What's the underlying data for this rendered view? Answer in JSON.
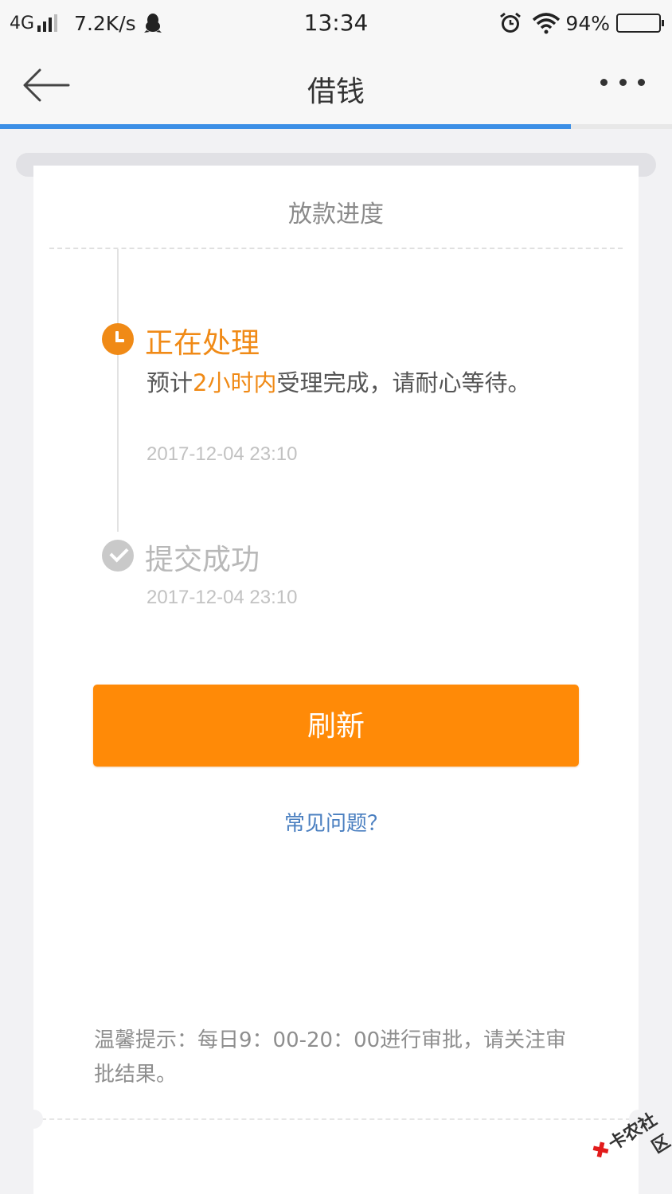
{
  "status_bar": {
    "network": "4G",
    "speed": "7.2K/s",
    "time": "13:34",
    "battery": "94%",
    "battery_level": 0.94
  },
  "nav": {
    "title": "借钱",
    "load_progress": 0.85
  },
  "card": {
    "title": "放款进度",
    "steps": [
      {
        "title": "正在处理",
        "desc_prefix": "预计",
        "desc_highlight": "2小时内",
        "desc_suffix": "受理完成，请耐心等待。",
        "time": "2017-12-04 23:10",
        "status": "processing",
        "icon": "clock-icon"
      },
      {
        "title": "提交成功",
        "time": "2017-12-04 23:10",
        "status": "done",
        "icon": "check-icon"
      }
    ],
    "refresh_label": "刷新",
    "faq_label": "常见问题？",
    "tip": "温馨提示：每日9：00-20：00进行审批，请关注审批结果。"
  },
  "watermark": {
    "text": "卡农社区"
  },
  "colors": {
    "accent": "#ff8a07",
    "link": "#4a7fc0",
    "progress": "#3c8fe6"
  }
}
